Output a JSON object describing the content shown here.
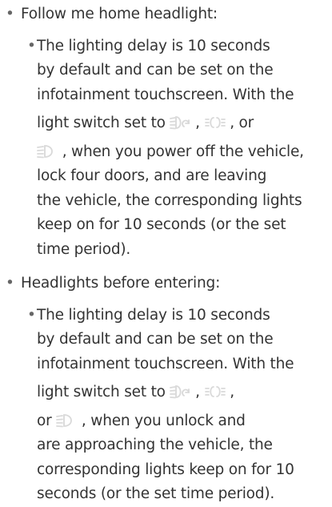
{
  "bullet_char": "•",
  "sub_bullet_char": "•",
  "icon_color": "#d9d9d9",
  "sections": [
    {
      "heading": "Follow me home headlight:",
      "lines": [
        "The lighting delay is 10 seconds",
        "by default and can be set on the",
        "infotainment touchscreen. With the",
        "light switch set to",
        ", when you power off the vehicle,",
        "lock four doors, and are leaving",
        "the vehicle, the corresponding lights",
        "keep on for 10 seconds (or the set",
        "time period)."
      ],
      "sep_1": ",",
      "sep_2": ", or"
    },
    {
      "heading": "Headlights before entering:",
      "lines": [
        "The lighting delay is 10 seconds",
        "by default and can be set on the",
        "infotainment touchscreen. With the",
        "light switch set to",
        "or",
        ", when you unlock and",
        "are approaching the vehicle, the",
        "corresponding lights keep on for 10",
        "seconds (or the set time period)."
      ],
      "sep_1": ",",
      "sep_2": ","
    }
  ],
  "icons": {
    "auto": "auto-light-icon",
    "position": "position-light-icon",
    "low_beam": "low-beam-icon"
  }
}
